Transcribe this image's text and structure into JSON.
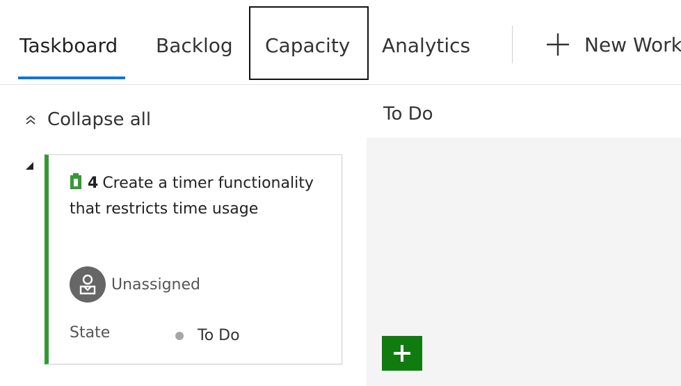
{
  "tabs": [
    {
      "label": "Taskboard",
      "active": true
    },
    {
      "label": "Backlog",
      "active": false
    },
    {
      "label": "Capacity",
      "active": false,
      "focused": true
    },
    {
      "label": "Analytics",
      "active": false
    }
  ],
  "new_work_item": {
    "label": "New Work",
    "icon": "plus-icon"
  },
  "toolbar": {
    "collapse_all": "Collapse all",
    "collapse_icon": "double-chevron-up-icon"
  },
  "card": {
    "id": "4",
    "title": "Create a timer functionality that restricts time usage",
    "type_icon": "task-icon",
    "assignee": "Unassigned",
    "state_label": "State",
    "state_value": "To Do"
  },
  "column": {
    "header": "To Do",
    "add_icon": "plus-icon"
  },
  "colors": {
    "accent": "#0078d4",
    "task_green": "#339933",
    "add_button": "#107c10",
    "column_bg": "#f4f4f4",
    "state_dot": "#a6a6a6"
  }
}
